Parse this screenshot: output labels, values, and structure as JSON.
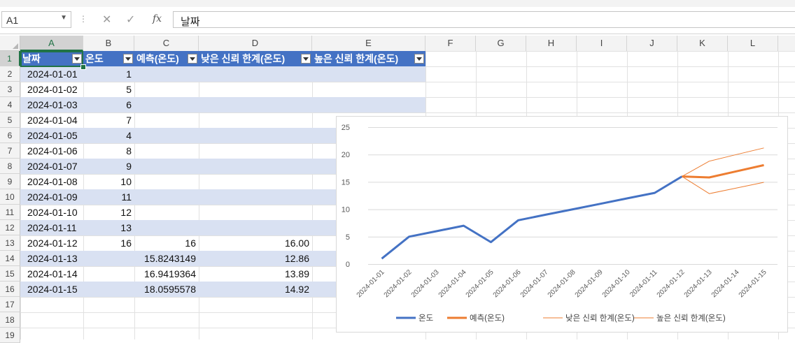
{
  "formula_bar": {
    "name_box": "A1",
    "value": "날짜",
    "fx_label": "fx"
  },
  "columns": [
    "A",
    "B",
    "C",
    "D",
    "E",
    "F",
    "G",
    "H",
    "I",
    "J",
    "K",
    "L"
  ],
  "rows": [
    "1",
    "2",
    "3",
    "4",
    "5",
    "6",
    "7",
    "8",
    "9",
    "10",
    "11",
    "12",
    "13",
    "14",
    "15",
    "16",
    "17",
    "18",
    "19"
  ],
  "table": {
    "headers": [
      "날짜",
      "온도",
      "예측(온도)",
      "낮은 신뢰 한계(온도)",
      "높은 신뢰 한계(온도)"
    ],
    "rows": [
      [
        "2024-01-01",
        "1",
        "",
        "",
        ""
      ],
      [
        "2024-01-02",
        "5",
        "",
        "",
        ""
      ],
      [
        "2024-01-03",
        "6",
        "",
        "",
        ""
      ],
      [
        "2024-01-04",
        "7",
        "",
        "",
        ""
      ],
      [
        "2024-01-05",
        "4",
        "",
        "",
        ""
      ],
      [
        "2024-01-06",
        "8",
        "",
        "",
        ""
      ],
      [
        "2024-01-07",
        "9",
        "",
        "",
        ""
      ],
      [
        "2024-01-08",
        "10",
        "",
        "",
        ""
      ],
      [
        "2024-01-09",
        "11",
        "",
        "",
        ""
      ],
      [
        "2024-01-10",
        "12",
        "",
        "",
        ""
      ],
      [
        "2024-01-11",
        "13",
        "",
        "",
        ""
      ],
      [
        "2024-01-12",
        "16",
        "16",
        "16.00",
        ""
      ],
      [
        "2024-01-13",
        "",
        "15.8243149",
        "12.86",
        ""
      ],
      [
        "2024-01-14",
        "",
        "16.9419364",
        "13.89",
        ""
      ],
      [
        "2024-01-15",
        "",
        "18.0595578",
        "14.92",
        ""
      ]
    ]
  },
  "colors": {
    "accent": "#217346",
    "table_header": "#4472c4",
    "table_band": "#d9e1f2",
    "series_actual": "#4472c4",
    "series_forecast": "#ed7d31"
  },
  "chart_data": {
    "type": "line",
    "x": [
      "2024-01-01",
      "2024-01-02",
      "2024-01-03",
      "2024-01-04",
      "2024-01-05",
      "2024-01-06",
      "2024-01-07",
      "2024-01-08",
      "2024-01-09",
      "2024-01-10",
      "2024-01-11",
      "2024-01-12",
      "2024-01-13",
      "2024-01-14",
      "2024-01-15"
    ],
    "ylim": [
      0,
      25
    ],
    "yticks": [
      "0",
      "5",
      "10",
      "15",
      "20",
      "25"
    ],
    "grid": true,
    "legend": "bottom",
    "series": [
      {
        "name": "온도",
        "color": "#4472c4",
        "width": 3,
        "values": [
          1,
          5,
          6,
          7,
          4,
          8,
          9,
          10,
          11,
          12,
          13,
          16,
          null,
          null,
          null
        ]
      },
      {
        "name": "예측(온도)",
        "color": "#ed7d31",
        "width": 3,
        "values": [
          null,
          null,
          null,
          null,
          null,
          null,
          null,
          null,
          null,
          null,
          null,
          16,
          15.82,
          16.94,
          18.06
        ]
      },
      {
        "name": "낮은 신뢰 한계(온도)",
        "color": "#ed7d31",
        "width": 1,
        "values": [
          null,
          null,
          null,
          null,
          null,
          null,
          null,
          null,
          null,
          null,
          null,
          16,
          12.86,
          13.89,
          14.92
        ]
      },
      {
        "name": "높은 신뢰 한계(온도)",
        "color": "#ed7d31",
        "width": 1,
        "values": [
          null,
          null,
          null,
          null,
          null,
          null,
          null,
          null,
          null,
          null,
          null,
          16,
          18.79,
          20.0,
          21.2
        ]
      }
    ]
  }
}
